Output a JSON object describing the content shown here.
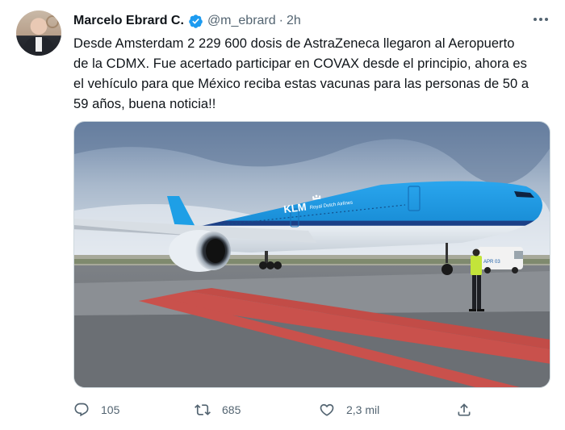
{
  "author": {
    "name": "Marcelo Ebrard C.",
    "handle": "@m_ebrard",
    "separator": "·",
    "time": "2h",
    "verified_color": "#1d9bf0"
  },
  "tweet": {
    "lines": [
      "Desde Amsterdam 2 229 600 dosis de AstraZeneca llegaron al Aeropuerto",
      "de la CDMX. Fue acertado participar en COVAX desde el principio, ahora es",
      "el vehículo para que México reciba estas vacunas para las personas de 50 a",
      "59 años, buena noticia!!"
    ]
  },
  "media": {
    "airline_logo": "KLM",
    "airline_name": "Royal Dutch Airlines",
    "vehicle_plate": "APR 03"
  },
  "actions": {
    "reply_count": "105",
    "retweet_count": "685",
    "like_count": "2,3 mil",
    "icons": [
      "reply-icon",
      "retweet-icon",
      "like-icon",
      "share-icon"
    ]
  },
  "colors": {
    "text": "#0f1419",
    "secondary": "#536471",
    "klm_blue": "#1e9fe6"
  }
}
